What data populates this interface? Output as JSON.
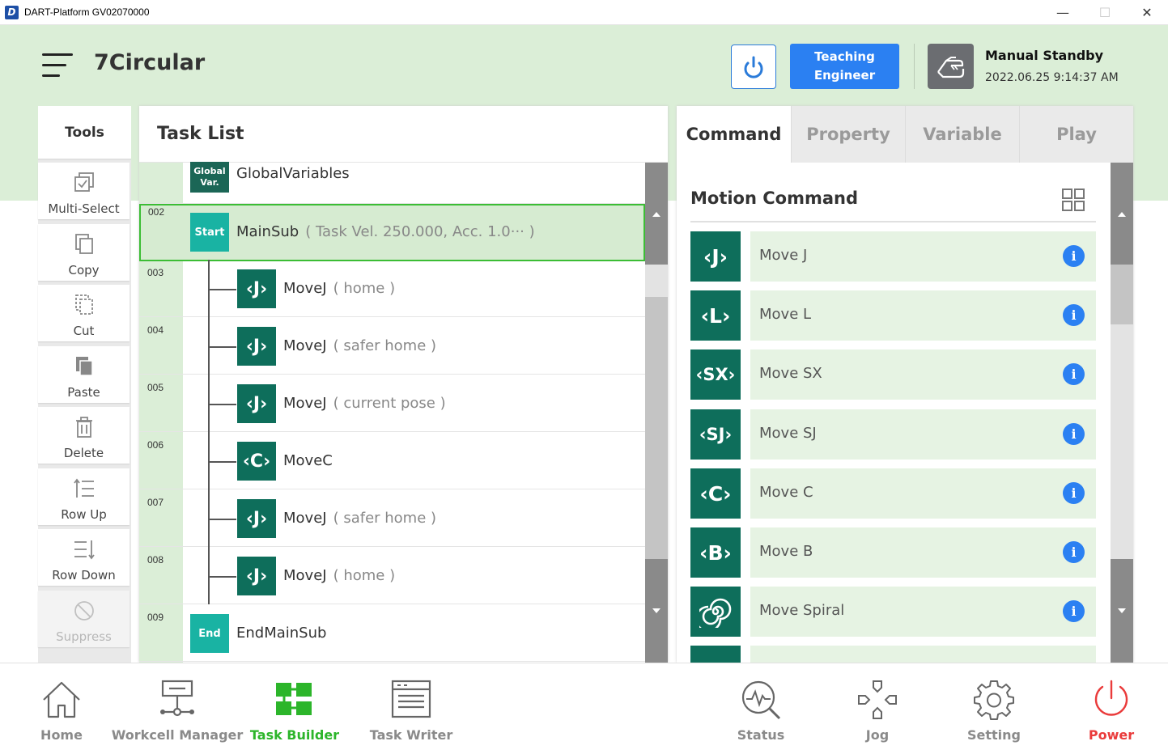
{
  "window": {
    "title": "DART-Platform GV02070000",
    "minimize": "—",
    "maximize": "☐",
    "close": "✕"
  },
  "header": {
    "title": "7Circular",
    "teach_line1": "Teaching",
    "teach_line2": "Engineer",
    "mode": "Manual Standby",
    "datetime": "2022.06.25 9:14:37 AM"
  },
  "tools": {
    "title": "Tools",
    "items": [
      {
        "label": "Multi-Select",
        "icon": "multi-select-icon"
      },
      {
        "label": "Copy",
        "icon": "copy-icon"
      },
      {
        "label": "Cut",
        "icon": "cut-icon"
      },
      {
        "label": "Paste",
        "icon": "paste-icon"
      },
      {
        "label": "Delete",
        "icon": "trash-icon"
      },
      {
        "label": "Row Up",
        "icon": "row-up-icon"
      },
      {
        "label": "Row Down",
        "icon": "row-down-icon"
      },
      {
        "label": "Suppress",
        "icon": "suppress-icon"
      }
    ]
  },
  "task_list": {
    "title": "Task List",
    "rows": [
      {
        "num": "",
        "block": "Global\nVar.",
        "block_line1": "Global",
        "block_line2": "Var.",
        "name": "GlobalVariables",
        "param": ""
      },
      {
        "num": "002",
        "block": "Start",
        "name": "MainSub",
        "param": "( Task Vel. 250.000, Acc. 1.0··· )"
      },
      {
        "num": "003",
        "block": "J",
        "name": "MoveJ",
        "param": "( home )"
      },
      {
        "num": "004",
        "block": "J",
        "name": "MoveJ",
        "param": "( safer home )"
      },
      {
        "num": "005",
        "block": "J",
        "name": "MoveJ",
        "param": "( current pose )"
      },
      {
        "num": "006",
        "block": "C",
        "name": "MoveC",
        "param": ""
      },
      {
        "num": "007",
        "block": "J",
        "name": "MoveJ",
        "param": "( safer home )"
      },
      {
        "num": "008",
        "block": "J",
        "name": "MoveJ",
        "param": "( home )"
      },
      {
        "num": "009",
        "block": "End",
        "name": "EndMainSub",
        "param": ""
      }
    ]
  },
  "command_panel": {
    "tabs": [
      "Command",
      "Property",
      "Variable",
      "Play"
    ],
    "active_tab": "Command",
    "section_title": "Motion Command",
    "commands": [
      {
        "glyph": "J",
        "label": "Move J"
      },
      {
        "glyph": "L",
        "label": "Move L"
      },
      {
        "glyph": "SX",
        "label": "Move SX"
      },
      {
        "glyph": "SJ",
        "label": "Move SJ"
      },
      {
        "glyph": "C",
        "label": "Move C"
      },
      {
        "glyph": "B",
        "label": "Move B"
      },
      {
        "glyph": "spiral",
        "label": "Move Spiral"
      }
    ],
    "info_glyph": "i"
  },
  "bottom_nav": {
    "items": [
      {
        "label": "Home",
        "icon": "home-icon"
      },
      {
        "label": "Workcell Manager",
        "icon": "workcell-icon"
      },
      {
        "label": "Task Builder",
        "icon": "task-builder-icon"
      },
      {
        "label": "Task Writer",
        "icon": "task-writer-icon"
      },
      {
        "label": "Status",
        "icon": "status-icon"
      },
      {
        "label": "Jog",
        "icon": "jog-icon"
      },
      {
        "label": "Setting",
        "icon": "gear-icon"
      },
      {
        "label": "Power",
        "icon": "power-icon"
      }
    ],
    "active": "Task Builder"
  },
  "colors": {
    "accent_green": "#2cb52a",
    "teach_blue": "#2b80f2",
    "block_teal": "#0e6e5b",
    "header_bg": "#dbeed7",
    "power_red": "#ea3b3b"
  }
}
